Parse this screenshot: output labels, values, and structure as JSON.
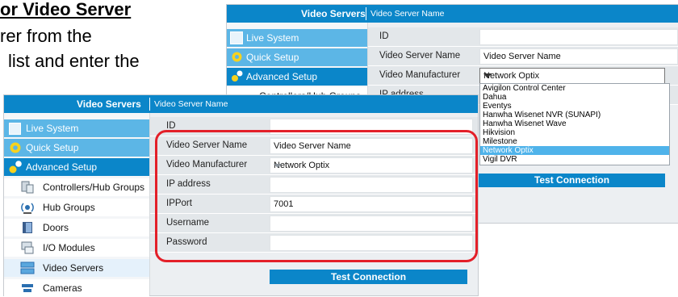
{
  "doc": {
    "heading": "or Video Server",
    "line2": "rer from the",
    "line3": "list and enter the"
  },
  "back_panel": {
    "header_title": "Video Servers",
    "header_subtitle": "Video Server Name",
    "sidebar": [
      "Live System",
      "Quick Setup",
      "Advanced Setup",
      "Controllers/Hub Groups"
    ],
    "fields": [
      {
        "label": "ID",
        "value": ""
      },
      {
        "label": "Video Server Name",
        "value": "Video Server Name"
      },
      {
        "label": "Video Manufacturer",
        "value": "Network Optix"
      },
      {
        "label": "IP address",
        "value": ""
      }
    ],
    "dropdown_options": [
      "Avigilon Control Center",
      "Dahua",
      "Eventys",
      "Hanwha Wisenet NVR (SUNAPI)",
      "Hanwha Wisenet Wave",
      "Hikvision",
      "Milestone",
      "Network Optix",
      "Vigil DVR"
    ],
    "selected_option": "Network Optix",
    "test_button": "Test Connection"
  },
  "front_panel": {
    "header_title": "Video Servers",
    "header_subtitle": "Video Server Name",
    "sidebar": [
      {
        "label": "Live System",
        "icon": "live-system-icon"
      },
      {
        "label": "Quick Setup",
        "icon": "gear-icon"
      },
      {
        "label": "Advanced Setup",
        "icon": "gears-icon"
      },
      {
        "label": "Controllers/Hub Groups",
        "icon": "controller-icon"
      },
      {
        "label": "Hub Groups",
        "icon": "hub-icon"
      },
      {
        "label": "Doors",
        "icon": "door-icon"
      },
      {
        "label": "I/O Modules",
        "icon": "io-module-icon"
      },
      {
        "label": "Video Servers",
        "icon": "video-server-icon"
      },
      {
        "label": "Cameras",
        "icon": "camera-icon"
      }
    ],
    "fields": [
      {
        "label": "ID",
        "value": ""
      },
      {
        "label": "Video Server Name",
        "value": "Video Server Name"
      },
      {
        "label": "Video Manufacturer",
        "value": "Network Optix"
      },
      {
        "label": "IP address",
        "value": ""
      },
      {
        "label": "IPPort",
        "value": "7001"
      },
      {
        "label": "Username",
        "value": ""
      },
      {
        "label": "Password",
        "value": ""
      }
    ],
    "test_button": "Test Connection"
  },
  "colors": {
    "header_blue": "#0b86c9",
    "light_blue": "#5cb6e6",
    "highlight_red": "#e32029",
    "selected_option": "#4fb3ea"
  }
}
